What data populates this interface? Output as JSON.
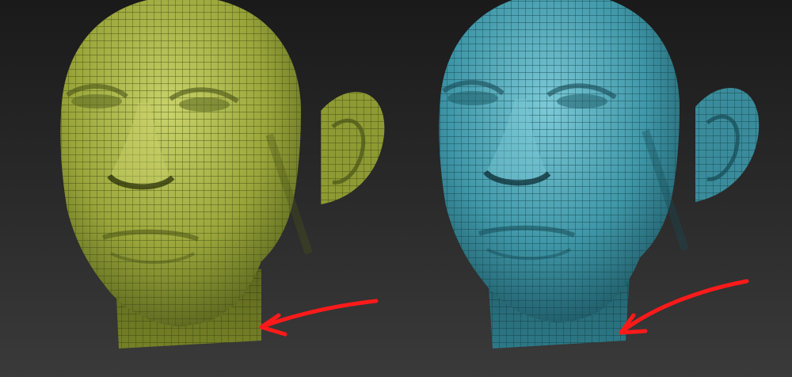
{
  "scene": {
    "background_top": "#1a1a1a",
    "background_bottom": "#3a3a3a"
  },
  "models": [
    {
      "name": "left-head",
      "base_color": "#9aa63a",
      "highlight_color": "#c9d36a",
      "shadow_color": "#4a5418",
      "wire_color": "#3d4612"
    },
    {
      "name": "right-head",
      "base_color": "#3f97a8",
      "highlight_color": "#7ccad8",
      "shadow_color": "#174a55",
      "wire_color": "#133f48"
    }
  ],
  "annotations": {
    "arrow_color": "#ff1a1a",
    "arrows": [
      {
        "target": "left-head-neck"
      },
      {
        "target": "right-head-neck"
      }
    ]
  }
}
